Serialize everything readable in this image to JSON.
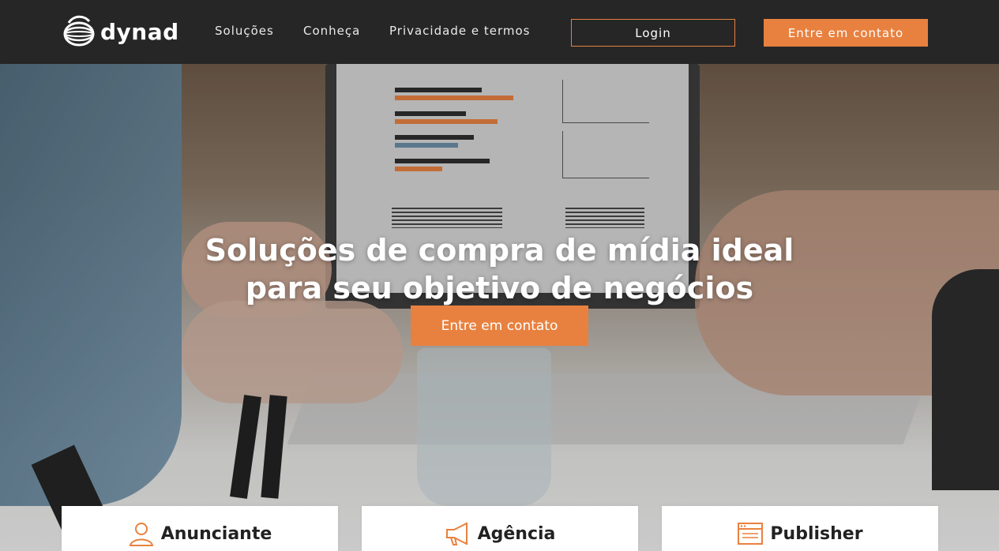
{
  "header": {
    "logo_text": "dynad",
    "nav": [
      "Soluções",
      "Conheça",
      "Privacidade e termos"
    ],
    "login_label": "Login",
    "contact_label": "Entre em contato"
  },
  "hero": {
    "title_line1": "Soluções de compra de mídia ideal",
    "title_line2": "para seu objetivo de negócios",
    "cta_label": "Entre em contato"
  },
  "cards": [
    {
      "label": "Anunciante",
      "icon": "user-icon"
    },
    {
      "label": "Agência",
      "icon": "megaphone-icon"
    },
    {
      "label": "Publisher",
      "icon": "browser-window-icon"
    }
  ],
  "colors": {
    "accent": "#e8813f",
    "header_bg": "#262626"
  }
}
